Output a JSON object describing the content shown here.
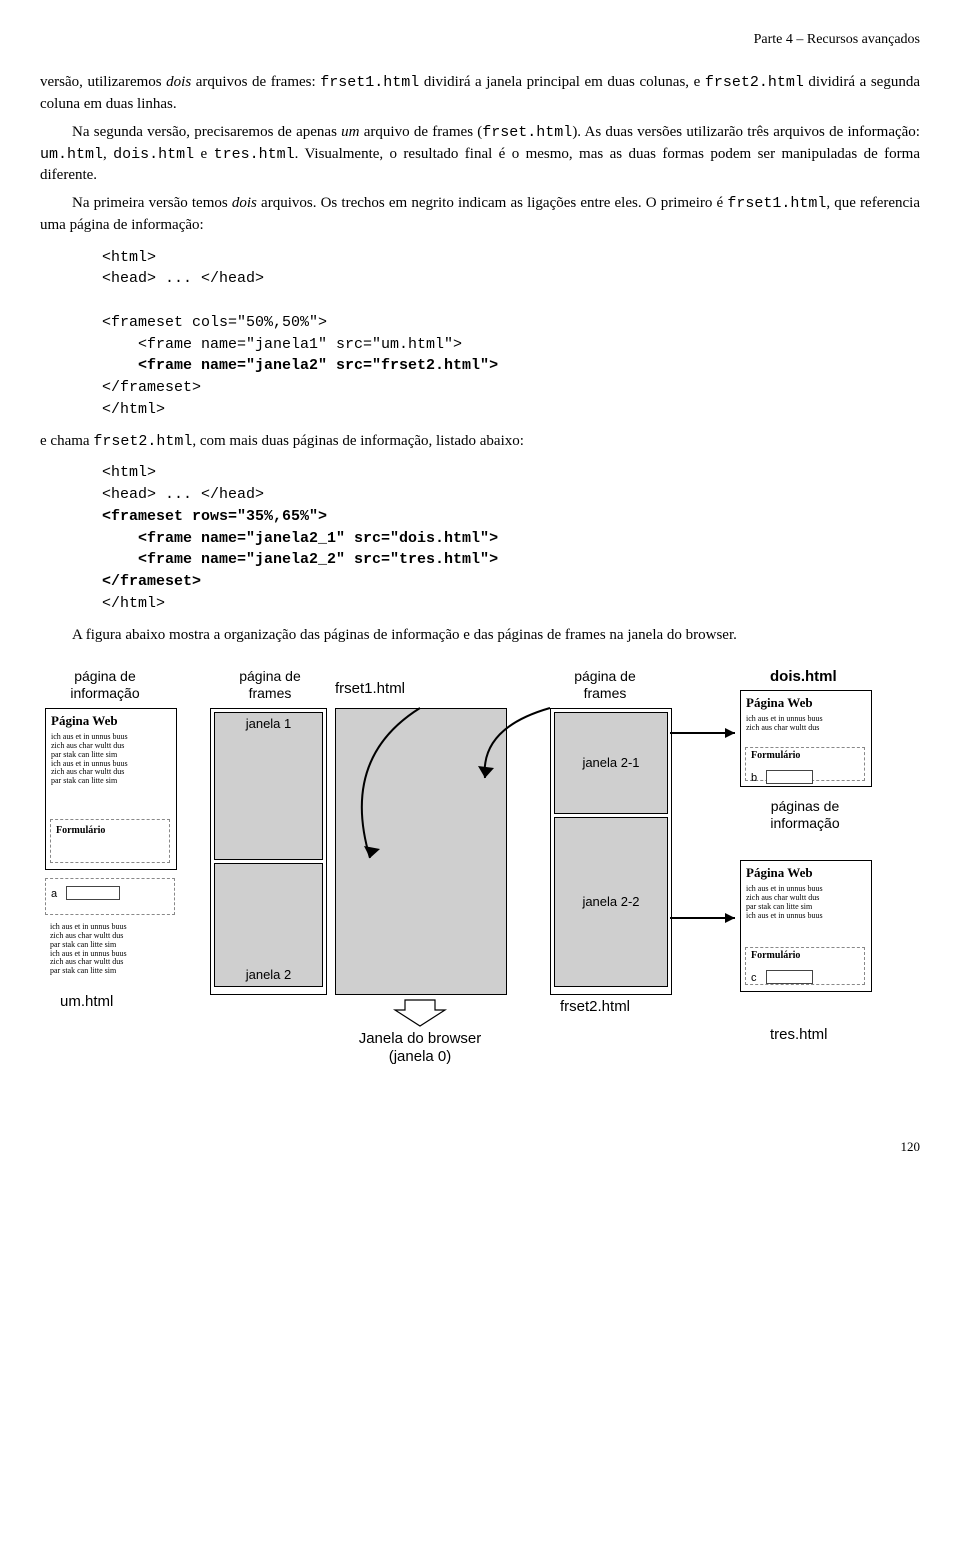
{
  "header": "Parte 4 – Recursos avançados",
  "p1a": "versão, utilizaremos ",
  "p1b": "dois",
  "p1c": " arquivos de frames: ",
  "p1d": "frset1.html",
  "p1e": " dividirá a janela principal em duas colunas, e ",
  "p1f": "frset2.html",
  "p1g": " dividirá a segunda coluna em duas linhas.",
  "p2a": "Na segunda versão, precisaremos de apenas ",
  "p2b": "um",
  "p2c": " arquivo de frames (",
  "p2d": "frset.html",
  "p2e": "). As duas versões utilizarão três arquivos de informação: ",
  "p2f": "um.html",
  "p2g": ", ",
  "p2h": "dois.html",
  "p2i": " e ",
  "p2j": "tres.html",
  "p2k": ". Visualmente, o resultado final é o mesmo, mas as duas formas podem ser manipuladas de forma diferente.",
  "p3a": "Na primeira versão temos ",
  "p3b": "dois",
  "p3c": " arquivos. Os trechos em negrito indicam as ligações entre eles. O primeiro é ",
  "p3d": "frset1.html",
  "p3e": ", que referencia uma página de informação:",
  "code1_l1": "<html>",
  "code1_l2": "<head> ... </head>",
  "code1_l3": "",
  "code1_l4": "<frameset cols=\"50%,50%\">",
  "code1_l5": "    <frame name=\"janela1\" src=\"um.html\">",
  "code1_l6": "    <frame name=\"janela2\" src=\"frset2.html\">",
  "code1_l7": "</frameset>",
  "code1_l8": "</html>",
  "p4a": "e chama ",
  "p4b": "frset2.html",
  "p4c": ", com mais duas páginas de informação, listado abaixo:",
  "code2_l1": "<html>",
  "code2_l2": "<head> ... </head>",
  "code2_l3": "<frameset rows=\"35%,65%\">",
  "code2_l4": "    <frame name=\"janela2_1\" src=\"dois.html\">",
  "code2_l5": "    <frame name=\"janela2_2\" src=\"tres.html\">",
  "code2_l6": "</frameset>",
  "code2_l7": "</html>",
  "p5": "A figura abaixo mostra a organização das páginas de informação e das páginas de frames na janela do browser.",
  "diag": {
    "lbl_info1": "página de\ninformação",
    "lbl_frames1": "página de\nframes",
    "lbl_frset1": "frset1.html",
    "lbl_frames2": "página de\nframes",
    "lbl_dois": "dois.html",
    "lbl_paginaweb": "Página Web",
    "lbl_tiny": "ich aus et in unnus buus\nzich aus char wultt dus\npar stak can litte sim\nich aus et in unnus buus\nzich aus char wultt dus\npar stak can litte sim",
    "lbl_tiny2": "ich aus et in unnus buus\nzich aus char wultt dus",
    "lbl_tiny3": "ich aus et in unnus buus\nzich aus char wultt dus\npar stak can litte sim\nich aus et in unnus buus",
    "lbl_formulario": "Formulário",
    "lbl_a": "a",
    "lbl_b": "b",
    "lbl_c": "c",
    "lbl_janela1": "janela 1",
    "lbl_janela2": "janela 2",
    "lbl_janela21": "janela 2-1",
    "lbl_janela22": "janela 2-2",
    "lbl_um": "um.html",
    "lbl_frset2": "frset2.html",
    "lbl_info2": "páginas de\ninformação",
    "lbl_tres": "tres.html",
    "lbl_browser": "Janela do browser\n(janela 0)"
  },
  "pagenum": "120"
}
